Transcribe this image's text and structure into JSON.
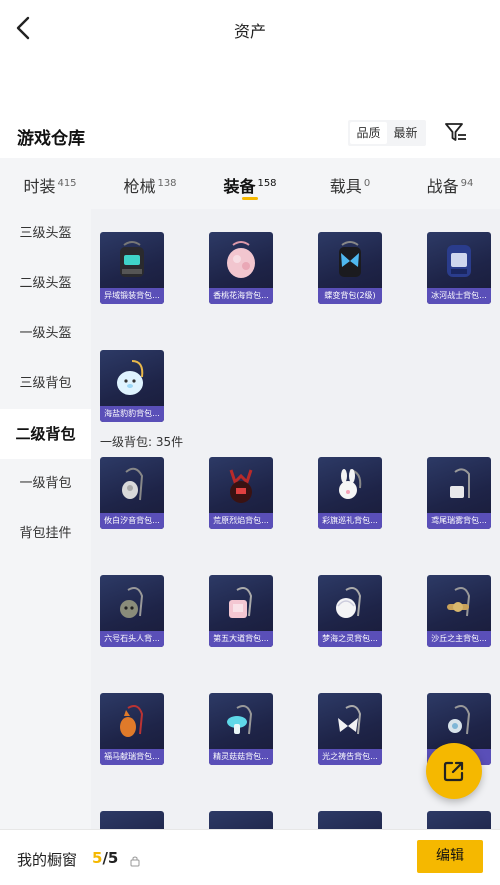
{
  "header": {
    "title": "资产"
  },
  "section": {
    "title": "游戏仓库",
    "sort_options": [
      "品质",
      "最新"
    ]
  },
  "tabs": [
    {
      "label": "时装",
      "count": "415"
    },
    {
      "label": "枪械",
      "count": "138"
    },
    {
      "label": "装备",
      "count": "158"
    },
    {
      "label": "载具",
      "count": "0"
    },
    {
      "label": "战备",
      "count": "94"
    }
  ],
  "sidebar": {
    "items": [
      "三级头盔",
      "二级头盔",
      "一级头盔",
      "三级背包",
      "二级背包",
      "一级背包",
      "背包挂件"
    ],
    "active_index": 4
  },
  "items_level2": [
    {
      "name": "异域锻装背包...",
      "icon": "black-teal-backpack-icon"
    },
    {
      "name": "香桃花海背包...",
      "icon": "pink-floral-backpack-icon"
    },
    {
      "name": "蝶变背包(2级)",
      "icon": "butterfly-backpack-icon"
    },
    {
      "name": "冰河战士背包...",
      "icon": "blue-armored-backpack-icon"
    },
    {
      "name": "海盐豹豹背包...",
      "icon": "white-seal-backpack-icon"
    }
  ],
  "group_label": "一级背包: 35件",
  "items_level1": [
    {
      "name": "攸白汐音背包...",
      "icon": "white-pouch-backpack-icon"
    },
    {
      "name": "荒原烈焰背包...",
      "icon": "red-demon-backpack-icon"
    },
    {
      "name": "彩旗巡礼背包...",
      "icon": "pink-bunny-backpack-icon"
    },
    {
      "name": "鸢尾瑞雾背包...",
      "icon": "white-purse-backpack-icon"
    },
    {
      "name": "六号石头人背...",
      "icon": "stone-golem-backpack-icon"
    },
    {
      "name": "第五大道背包...",
      "icon": "pink-handbag-backpack-icon"
    },
    {
      "name": "梦海之灵背包...",
      "icon": "white-shell-backpack-icon"
    },
    {
      "name": "沙丘之主背包...",
      "icon": "dune-lord-backpack-icon"
    },
    {
      "name": "福马献瑞背包...",
      "icon": "orange-horse-backpack-icon"
    },
    {
      "name": "精灵菇菇背包...",
      "icon": "cyan-mushroom-backpack-icon"
    },
    {
      "name": "光之祷告背包...",
      "icon": "white-wing-backpack-icon"
    },
    {
      "name": "",
      "icon": "round-charm-backpack-icon"
    }
  ],
  "bottom": {
    "label": "我的橱窗",
    "current": "5",
    "total": "/5",
    "edit_label": "编辑"
  },
  "colors": {
    "accent": "#f5b800",
    "card_bg": "#1e2448",
    "name_strip": "#5a4fb8"
  }
}
